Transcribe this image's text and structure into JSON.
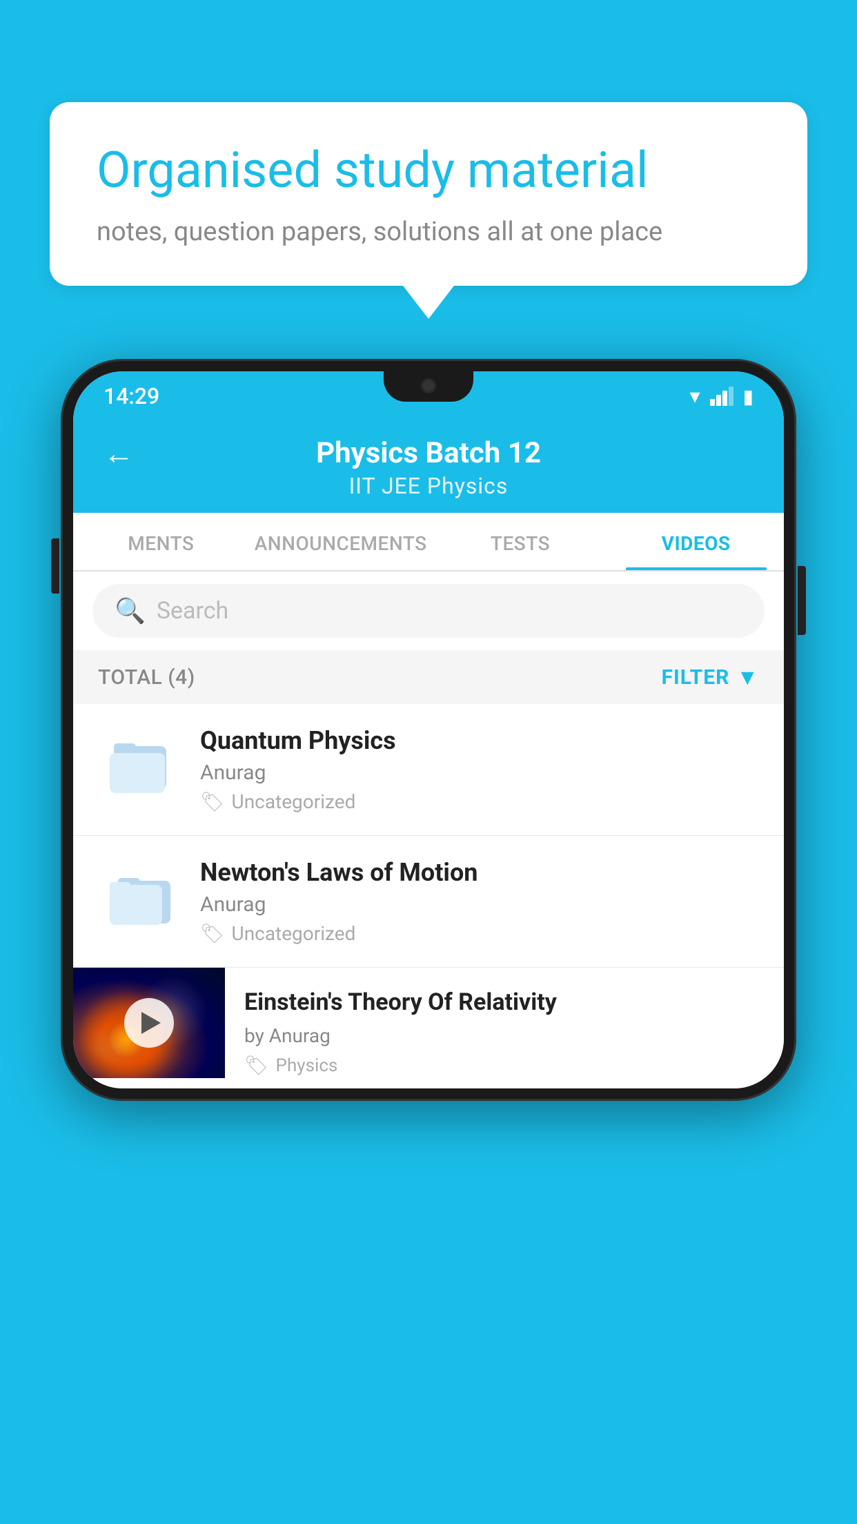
{
  "background_color": "#1ABDE8",
  "speech_bubble": {
    "title": "Organised study material",
    "subtitle": "notes, question papers, solutions all at one place"
  },
  "status_bar": {
    "time": "14:29",
    "icons": [
      "wifi",
      "signal",
      "battery"
    ]
  },
  "app_header": {
    "title": "Physics Batch 12",
    "subtitle": "IIT JEE   Physics",
    "back_label": "←"
  },
  "tabs": [
    {
      "label": "MENTS",
      "active": false
    },
    {
      "label": "ANNOUNCEMENTS",
      "active": false
    },
    {
      "label": "TESTS",
      "active": false
    },
    {
      "label": "VIDEOS",
      "active": true
    }
  ],
  "search": {
    "placeholder": "Search"
  },
  "filter_bar": {
    "total_label": "TOTAL (4)",
    "filter_label": "FILTER"
  },
  "videos": [
    {
      "id": 1,
      "title": "Quantum Physics",
      "author": "Anurag",
      "tag": "Uncategorized",
      "type": "folder"
    },
    {
      "id": 2,
      "title": "Newton's Laws of Motion",
      "author": "Anurag",
      "tag": "Uncategorized",
      "type": "folder"
    },
    {
      "id": 3,
      "title": "Einstein's Theory Of Relativity",
      "author": "by Anurag",
      "tag": "Physics",
      "type": "video"
    }
  ]
}
